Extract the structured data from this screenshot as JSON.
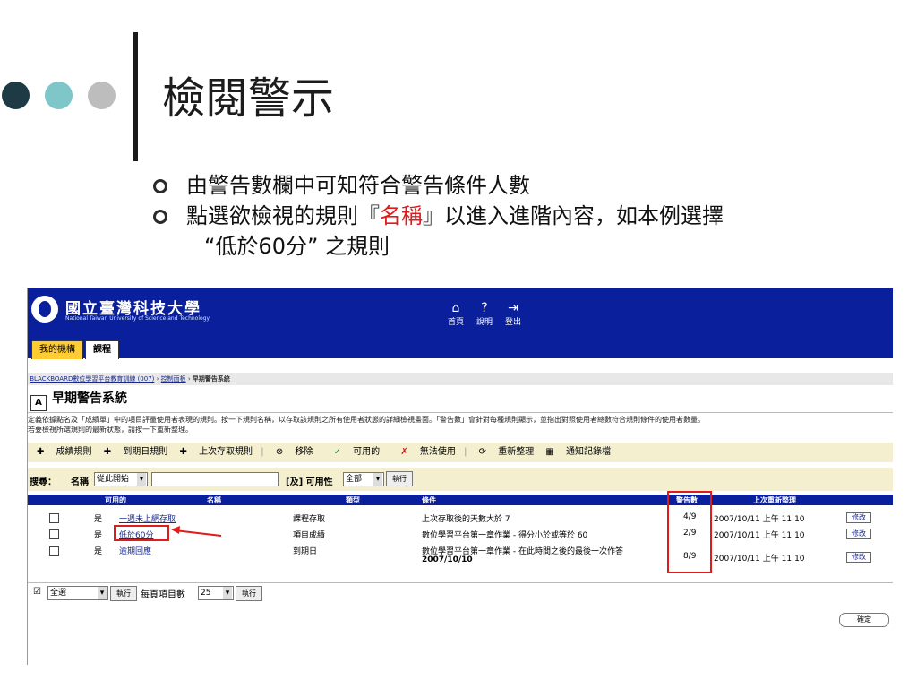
{
  "slide": {
    "title": "檢閱警示",
    "bullets": [
      {
        "text": "由警告數欄中可知符合警告條件人數"
      },
      {
        "pre": "點選欲檢視的規則『",
        "highlight": "名稱",
        "post": "』以進入進階內容，如本例選擇"
      },
      {
        "text": "“低於60分” 之規則"
      }
    ]
  },
  "colors": {
    "dot1": "#1e3a44",
    "dot2": "#7fc6c9",
    "dot3": "#bdbdbd",
    "accent_red": "#e01b1b",
    "header_blue": "#0a1f9c",
    "toolbar_bg": "#f4efcf"
  },
  "app": {
    "university_name": "國立臺灣科技大學",
    "university_en": "National Taiwan University of Science and Technology",
    "top_nav": [
      {
        "icon": "home-icon",
        "label": "首頁"
      },
      {
        "icon": "help-icon",
        "label": "說明"
      },
      {
        "icon": "logout-icon",
        "label": "登出"
      }
    ],
    "tabs": [
      "我的機構",
      "課程"
    ],
    "breadcrumb": [
      "BLACKBOARD數位學習平台教育訓練 (007)",
      "控制面板",
      "早期警告系統"
    ],
    "page_title": "早期警告系統",
    "description_line1": "定義依據點名及「成績單」中的項目評量使用者表現的規則。按一下規則名稱，以存取該規則之所有使用者狀態的詳細檢視畫面。「警告數」會針對每種規則顯示，並指出對照使用者總數符合規則條件的使用者數量。",
    "description_line2": "若要檢視所選規則的最新狀態，請按一下重新整理。",
    "action_bar": [
      "成績規則",
      "到期日規則",
      "上次存取規則",
      "移除",
      "可用的",
      "無法使用",
      "重新整理",
      "通知記錄檔"
    ],
    "search": {
      "label": "搜尋：",
      "name_label": "名稱",
      "match_option": "從此開始",
      "query": "",
      "and_label": "[及] 可用性",
      "availability_option": "全部",
      "go_label": "執行"
    },
    "table": {
      "headers": [
        "可用的",
        "名稱",
        "類型",
        "條件",
        "警告數",
        "上次重新整理"
      ],
      "rows": [
        {
          "available": "是",
          "name": "一週未上網存取",
          "type": "課程存取",
          "condition": "上次存取後的天數大於 7",
          "condition_extra": "",
          "warnings": "4/9",
          "refreshed": "2007/10/11 上午 11:10",
          "action": "修改"
        },
        {
          "available": "是",
          "name": "低於60分",
          "type": "項目成績",
          "condition": "數位學習平台第一章作業 - 得分小於或等於 60",
          "condition_extra": "",
          "warnings": "2/9",
          "refreshed": "2007/10/11 上午 11:10",
          "action": "修改"
        },
        {
          "available": "是",
          "name": "逾期回應",
          "type": "到期日",
          "condition": "數位學習平台第一章作業 - 在此時間之後的最後一次作答",
          "condition_extra": "2007/10/10",
          "warnings": "8/9",
          "refreshed": "2007/10/11 上午 11:10",
          "action": "修改"
        }
      ]
    },
    "bottom": {
      "select_all": "全選",
      "go_label": "執行",
      "per_page_label": "每頁項目數",
      "per_page_value": "25",
      "go2_label": "執行"
    },
    "ok_label": "確定"
  }
}
